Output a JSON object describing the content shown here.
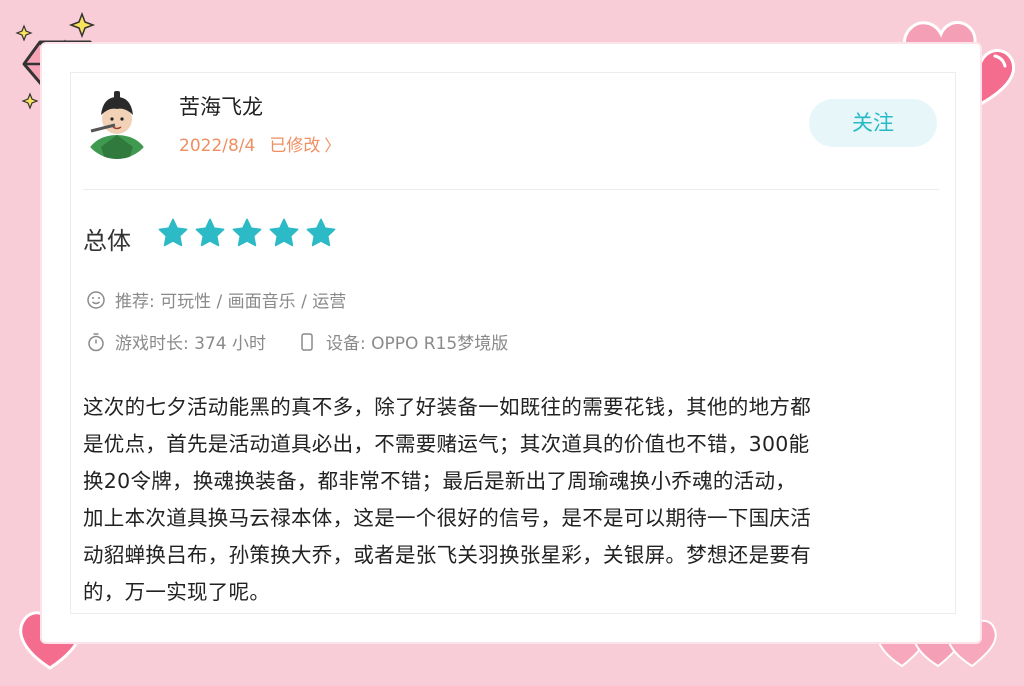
{
  "user": {
    "name": "苦海飞龙",
    "date": "2022/8/4",
    "edited_label": "已修改"
  },
  "follow_button": {
    "label": "关注"
  },
  "rating": {
    "label": "总体",
    "stars": 5,
    "star_color": "#2bbac6"
  },
  "recommend": {
    "text": "推荐: 可玩性 / 画面音乐 / 运营"
  },
  "playtime": {
    "text": "游戏时长:  374 小时"
  },
  "device": {
    "text": "设备:  OPPO R15梦境版"
  },
  "review": {
    "lines": [
      "这次的七夕活动能黑的真不多，除了好装备一如既往的需要花钱，其他的地方都",
      "是优点，首先是活动道具必出，不需要赌运气；其次道具的价值也不错，300能",
      "换20令牌，换魂换装备，都非常不错；最后是新出了周瑜魂换小乔魂的活动，",
      "加上本次道具换马云禄本体，这是一个很好的信号，是不是可以期待一下国庆活",
      "动貂蝉换吕布，孙策换大乔，或者是张飞关羽换张星彩，关银屏。梦想还是要有",
      "的，万一实现了呢。"
    ]
  },
  "colors": {
    "background": "#f9cdd8",
    "accent": "#2bbac6",
    "meta": "#ef8f62",
    "heart": "#f46d8e"
  }
}
